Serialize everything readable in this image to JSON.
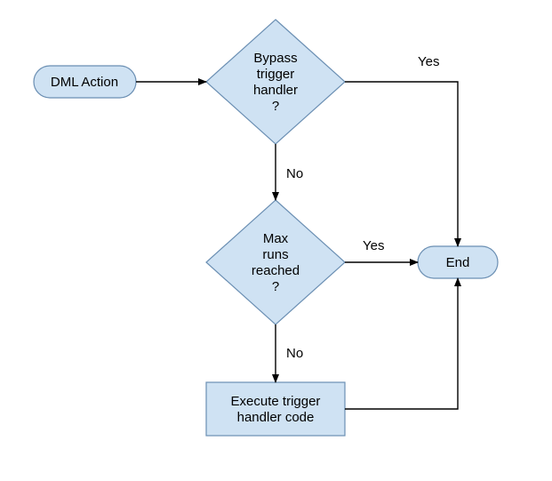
{
  "flowchart": {
    "nodes": {
      "start": {
        "label": "DML Action"
      },
      "decision1": {
        "line1": "Bypass",
        "line2": "trigger",
        "line3": "handler",
        "line4": "?"
      },
      "decision2": {
        "line1": "Max",
        "line2": "runs",
        "line3": "reached",
        "line4": "?"
      },
      "process": {
        "line1": "Execute trigger",
        "line2": "handler code"
      },
      "end": {
        "label": "End"
      }
    },
    "edges": {
      "d1_yes": "Yes",
      "d1_no": "No",
      "d2_yes": "Yes",
      "d2_no": "No"
    }
  },
  "chart_data": {
    "type": "flowchart",
    "nodes": [
      {
        "id": "start",
        "type": "terminator",
        "label": "DML Action"
      },
      {
        "id": "d1",
        "type": "decision",
        "label": "Bypass trigger handler ?"
      },
      {
        "id": "d2",
        "type": "decision",
        "label": "Max runs reached ?"
      },
      {
        "id": "p1",
        "type": "process",
        "label": "Execute trigger handler code"
      },
      {
        "id": "end",
        "type": "terminator",
        "label": "End"
      }
    ],
    "edges": [
      {
        "from": "start",
        "to": "d1",
        "label": ""
      },
      {
        "from": "d1",
        "to": "end",
        "label": "Yes"
      },
      {
        "from": "d1",
        "to": "d2",
        "label": "No"
      },
      {
        "from": "d2",
        "to": "end",
        "label": "Yes"
      },
      {
        "from": "d2",
        "to": "p1",
        "label": "No"
      },
      {
        "from": "p1",
        "to": "end",
        "label": ""
      }
    ]
  }
}
